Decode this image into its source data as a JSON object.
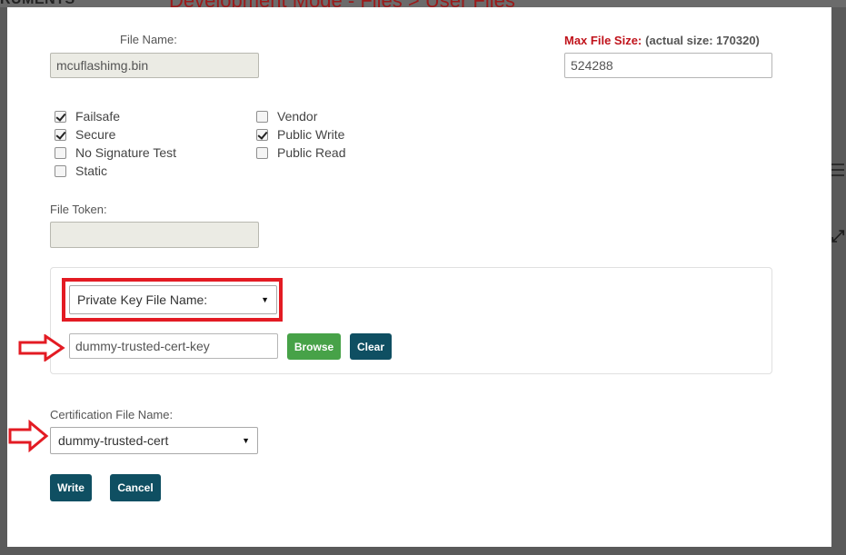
{
  "background": {
    "left_heading": "RUMENTS",
    "title": "Development Mode - Files > User Files"
  },
  "form": {
    "file_name_label": "File Name:",
    "file_name_value": "mcuflashimg.bin",
    "max_size_label": "Max File Size:",
    "max_size_actual": "(actual size: 170320)",
    "max_size_value": "524288",
    "checkboxes_left": [
      {
        "label": "Failsafe",
        "checked": true
      },
      {
        "label": "Secure",
        "checked": true
      },
      {
        "label": "No Signature Test",
        "checked": false
      },
      {
        "label": "Static",
        "checked": false
      }
    ],
    "checkboxes_right": [
      {
        "label": "Vendor",
        "checked": false
      },
      {
        "label": "Public Write",
        "checked": true
      },
      {
        "label": "Public Read",
        "checked": false
      }
    ],
    "file_token_label": "File Token:",
    "file_token_value": "",
    "key_select_value": "Private Key File Name:",
    "key_file_value": "dummy-trusted-cert-key",
    "browse_label": "Browse",
    "clear_label": "Clear",
    "cert_label": "Certification File Name:",
    "cert_select_value": "dummy-trusted-cert",
    "write_label": "Write",
    "cancel_label": "Cancel"
  },
  "colors": {
    "annotation_red": "#e31b23",
    "browse_green": "#47a248",
    "button_teal": "#0f4f62",
    "max_size_red": "#c0131b"
  },
  "icons": {
    "dropdown": "caret-down-icon",
    "annotation": "arrow-right-icon"
  }
}
